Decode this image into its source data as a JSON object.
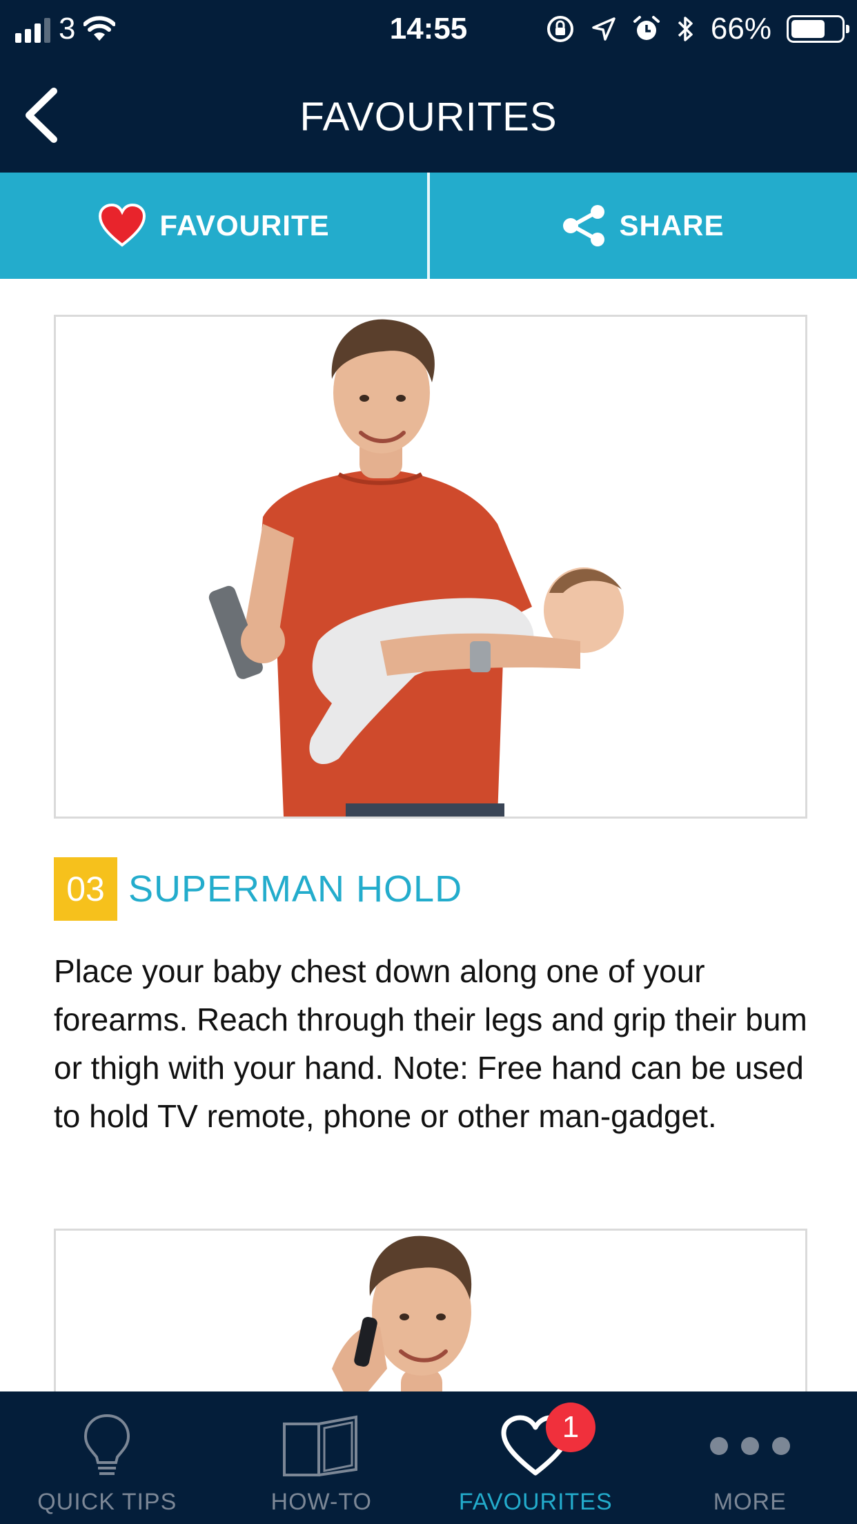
{
  "status_bar": {
    "carrier": "3",
    "time": "14:55",
    "battery_percent": "66%",
    "battery_level": 0.66,
    "icons": [
      "signal-icon",
      "wifi-icon",
      "rotation-lock-icon",
      "location-icon",
      "alarm-icon",
      "bluetooth-icon",
      "battery-icon"
    ]
  },
  "header": {
    "title": "FAVOURITES",
    "back_icon": "chevron-left-icon"
  },
  "actions": {
    "favourite_label": "FAVOURITE",
    "favourite_icon": "heart-icon",
    "share_label": "SHARE",
    "share_icon": "share-icon"
  },
  "tips": [
    {
      "number": "03",
      "title": "SUPERMAN HOLD",
      "body": "Place your baby chest down along one of your forearms. Reach through their legs and grip their bum or thigh with your hand. Note: Free hand can be used to hold TV remote, phone or other man-gadget.",
      "image": "man-holding-baby-and-remote-photo"
    },
    {
      "image": "man-on-phone-photo"
    }
  ],
  "tab_bar": {
    "tabs": [
      {
        "label": "QUICK TIPS",
        "icon": "lightbulb-icon",
        "active": false
      },
      {
        "label": "HOW-TO",
        "icon": "book-icon",
        "active": false
      },
      {
        "label": "FAVOURITES",
        "icon": "heart-outline-icon",
        "active": true,
        "badge": "1"
      },
      {
        "label": "MORE",
        "icon": "more-dots-icon",
        "active": false
      }
    ]
  },
  "colors": {
    "navy": "#041e3a",
    "accent": "#23accc",
    "number_badge": "#f6c11c",
    "heart_red": "#e8242c",
    "badge_red": "#f0303c",
    "inactive_tab": "#7c8796"
  }
}
